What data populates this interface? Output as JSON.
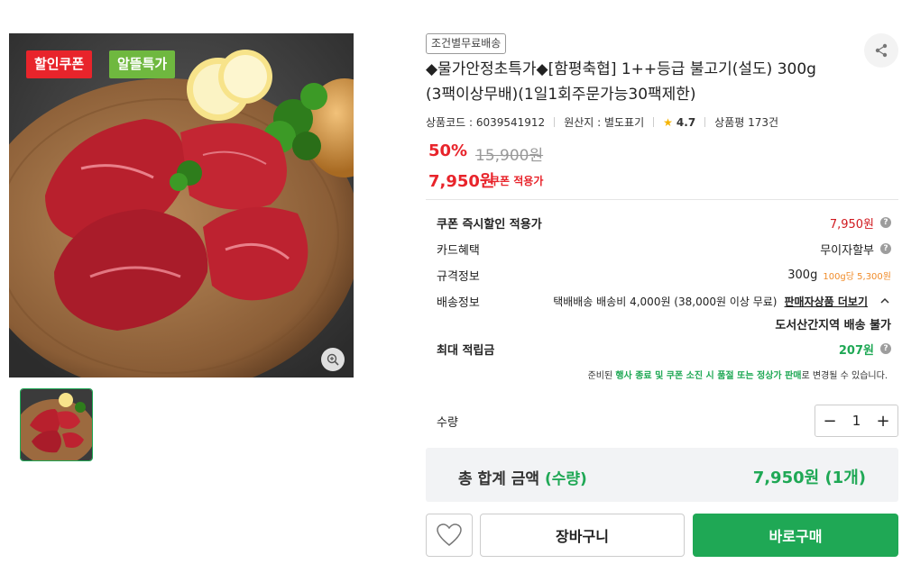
{
  "gallery": {
    "badges": [
      "할인쿠폰",
      "알뜰특가"
    ],
    "zoom_icon": "zoom-in-icon"
  },
  "product": {
    "shipping_tag": "조건별무료배송",
    "title_line1": "◆물가안정초특가◆[함평축협] 1++등급 불고기(설도) 300g",
    "title_line2": "(3팩이상무배)(1일1회주문가능30팩제한)",
    "code_label": "상품코드 : 6039541912",
    "origin_label": "원산지 : 별도표기",
    "rating": "4.7",
    "review_label": "상품평 173건"
  },
  "price": {
    "discount": "50%",
    "original": "15,900원",
    "sale": "7,950원",
    "coupon_note": "쿠폰 적용가"
  },
  "details": {
    "coupon_row": {
      "label": "쿠폰 즉시할인 적용가",
      "value": "7,950원"
    },
    "card_row": {
      "label": "카드혜택",
      "value": "무이자할부"
    },
    "spec_row": {
      "label": "규격정보",
      "value": "300g",
      "unit_price": "100g당 5,300원"
    },
    "delivery_row": {
      "label": "배송정보",
      "value": "택배배송  배송비 4,000원 (38,000원 이상 무료)",
      "seller_link": "판매자상품 더보기",
      "remote_note": "도서산간지역 배송 불가"
    },
    "points_row": {
      "label": "최대 적립금",
      "value": "207원"
    },
    "notice_pre": "준비된 ",
    "notice_highlight": "행사 종료 및 쿠폰 소진 시 품절 또는 정상가 판매",
    "notice_post": "로 변경될 수 있습니다."
  },
  "quantity": {
    "label": "수량",
    "value": "1",
    "minus": "−",
    "plus": "+"
  },
  "total": {
    "label": "총 합계 금액",
    "label_sub": "(수량)",
    "value": "7,950원 (1개)"
  },
  "actions": {
    "cart": "장바구니",
    "buy": "바로구매"
  },
  "colors": {
    "accent_green": "#1fa855",
    "sale_red": "#e8242b",
    "coupon_badge": "#e8242b",
    "deal_badge": "#6fb83f"
  }
}
